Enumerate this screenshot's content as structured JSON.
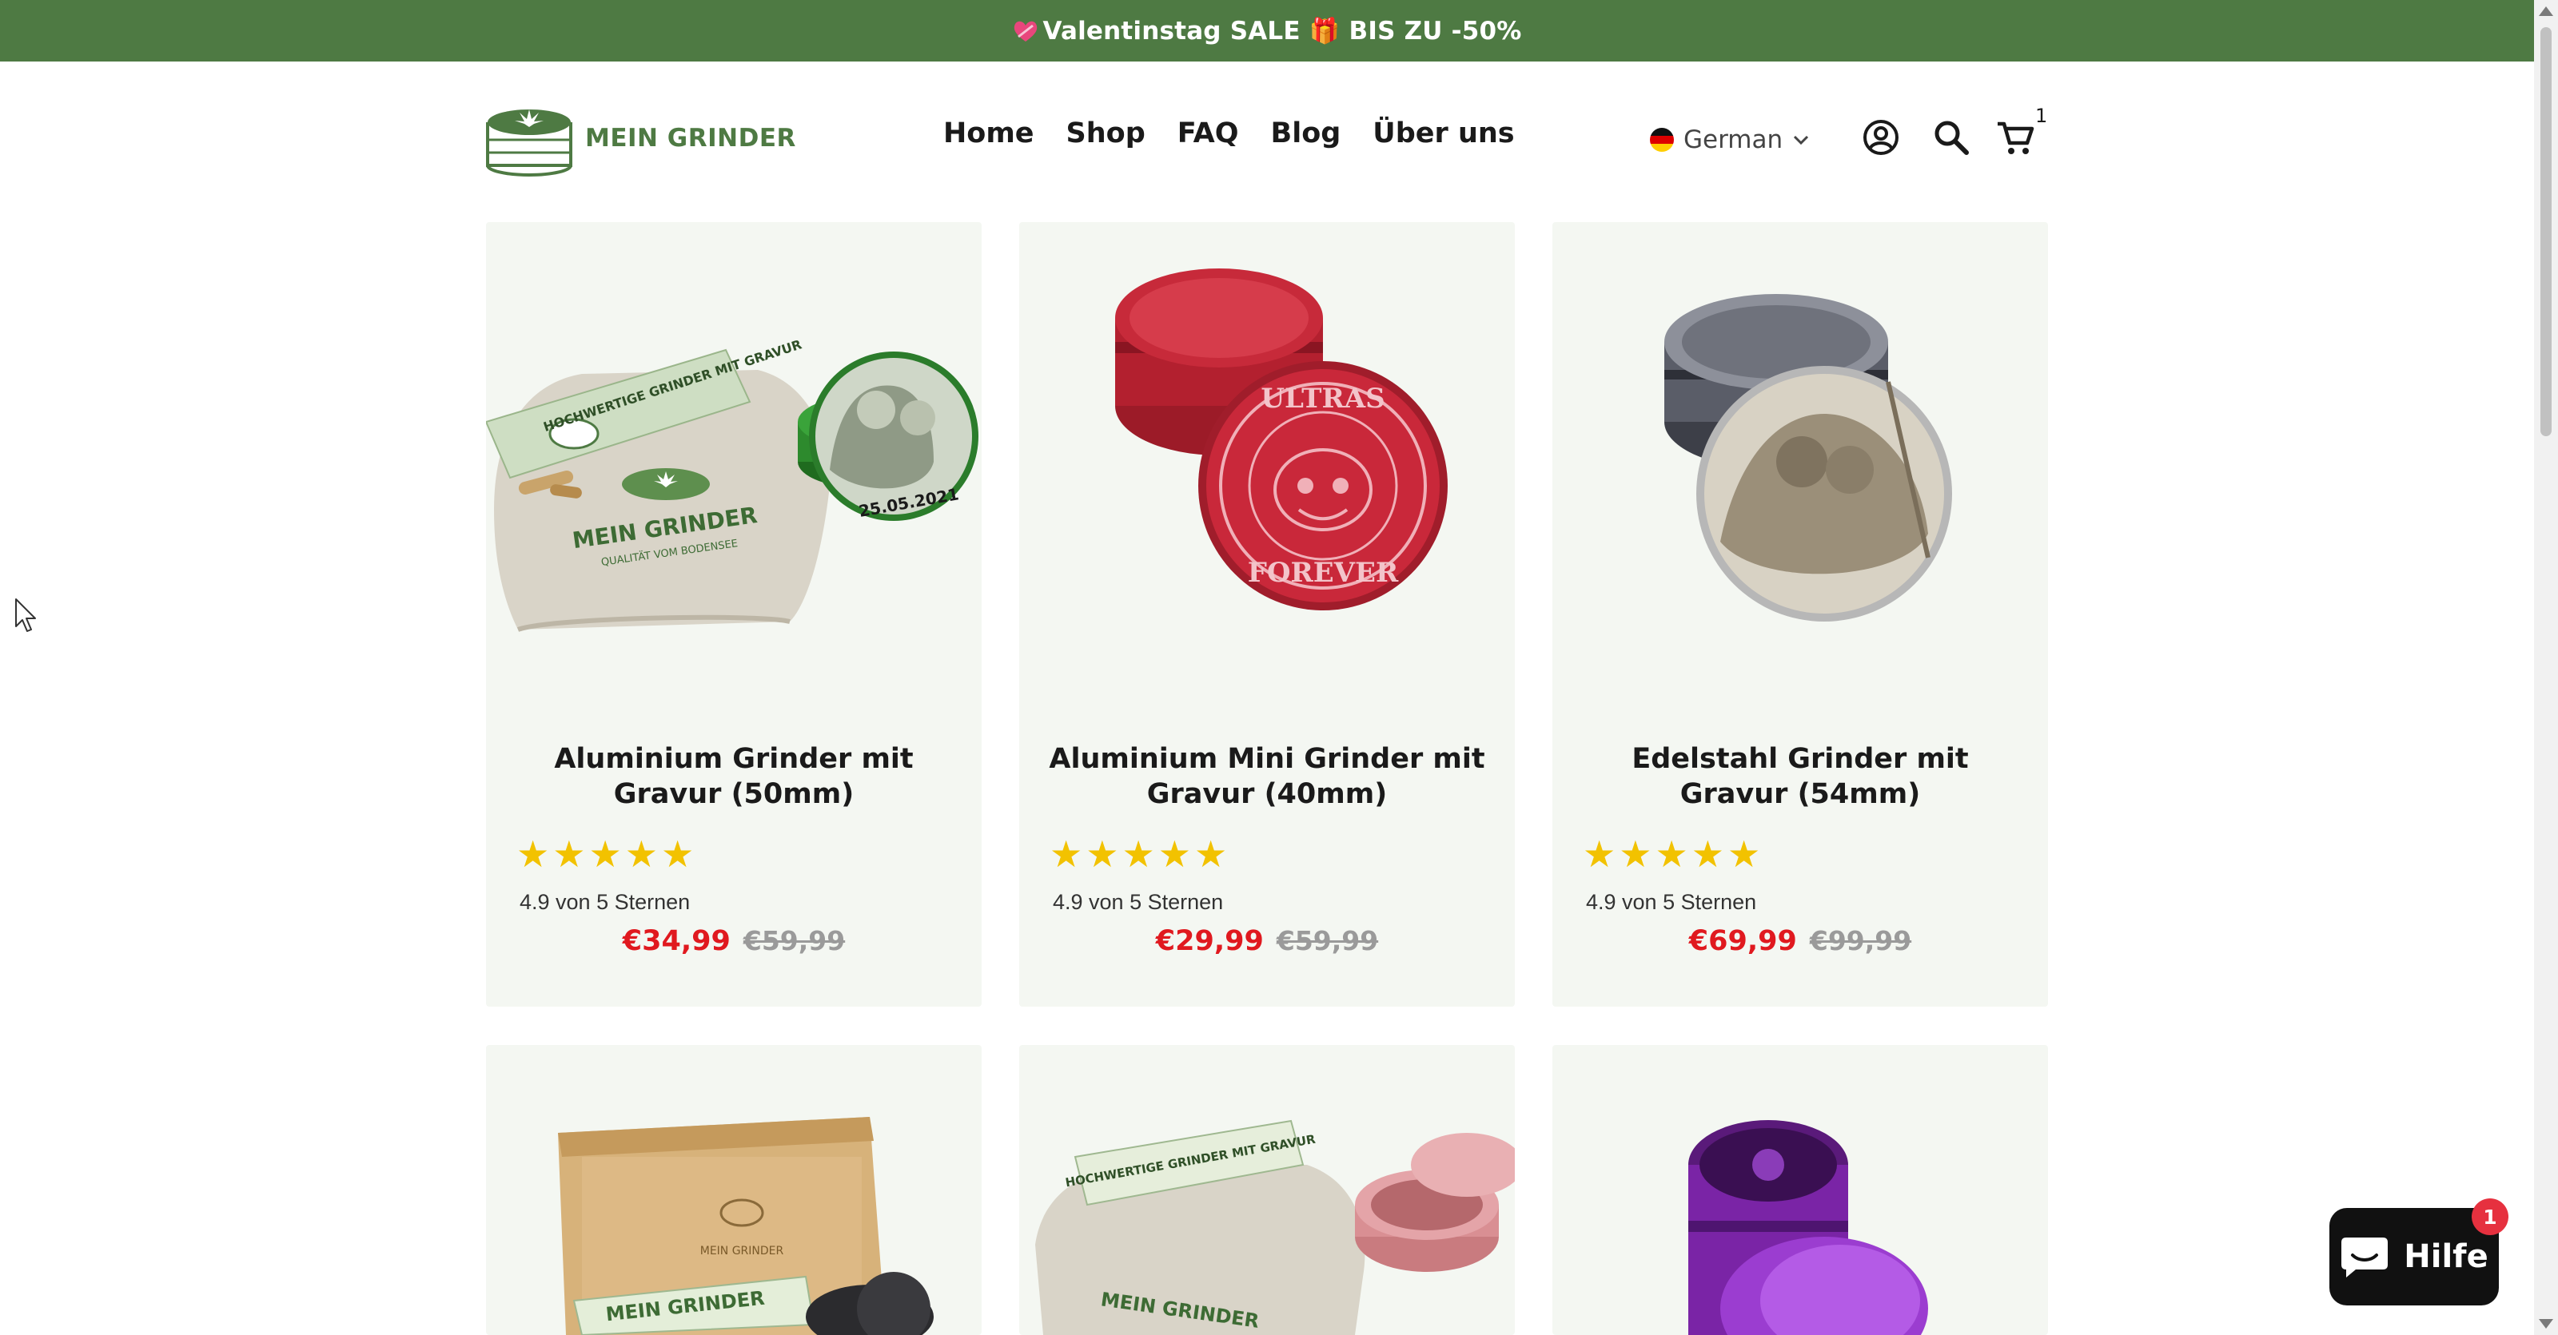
{
  "announcement": {
    "text": "Valentinstag SALE 🎁 BIS ZU -50%",
    "bg_color": "#4e7a43",
    "icon": "heart-icon"
  },
  "header": {
    "logo_text": "MEIN GRINDER",
    "nav": [
      "Home",
      "Shop",
      "FAQ",
      "Blog",
      "Über uns"
    ],
    "language": "German",
    "cart_count": "1",
    "icons": [
      "account-icon",
      "search-icon",
      "cart-icon"
    ]
  },
  "products": [
    {
      "title": "Aluminium Grinder mit Gravur (50mm)",
      "rating_text": "4.9 von 5 Sternen",
      "stars": 5,
      "sale_price": "€34,99",
      "old_price": "€59,99",
      "image": "green-grinder-with-pouch",
      "image_text": {
        "pouch": "MEIN GRINDER",
        "pouch_sub": "QUALITÄT VOM BODENSEE",
        "card": "HOCHWERTIGE GRINDER MIT GRAVUR",
        "date": "25.05.2021"
      }
    },
    {
      "title": "Aluminium Mini Grinder mit Gravur (40mm)",
      "rating_text": "4.9 von 5 Sternen",
      "stars": 5,
      "sale_price": "€29,99",
      "old_price": "€59,99",
      "image": "red-mini-grinder",
      "image_text": {
        "engraving_top": "ULTRAS",
        "engraving_bottom": "FOREVER"
      }
    },
    {
      "title": "Edelstahl Grinder mit Gravur (54mm)",
      "rating_text": "4.9 von 5 Sternen",
      "stars": 5,
      "sale_price": "€69,99",
      "old_price": "€99,99",
      "image": "steel-grinder-photo-engraving"
    },
    {
      "image": "bamboo-box-with-grinder",
      "image_text": {
        "box": "MEIN GRINDER",
        "paper": "MEIN GRINDER"
      }
    },
    {
      "image": "pink-grinder-with-pouch",
      "image_text": {
        "card": "HOCHWERTIGE GRINDER MIT GRAVUR",
        "pouch": "MEIN GRINDER"
      }
    },
    {
      "image": "purple-grinder"
    }
  ],
  "chat": {
    "label": "Hilfe",
    "badge": "1"
  },
  "colors": {
    "brand_green": "#4e7a43",
    "sale_red": "#e0191f",
    "star_yellow": "#f2c200",
    "card_bg": "#f4f7f2"
  }
}
